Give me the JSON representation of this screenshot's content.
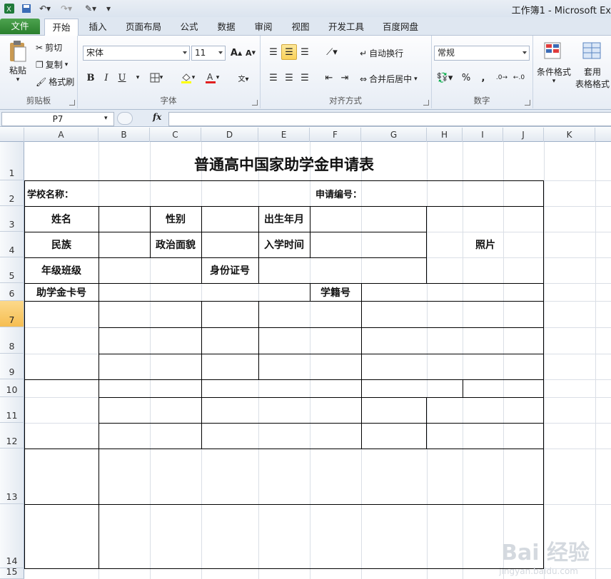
{
  "window": {
    "title": "工作簿1 - Microsoft Ex"
  },
  "tabs": [
    {
      "label": "文件"
    },
    {
      "label": "开始"
    },
    {
      "label": "插入"
    },
    {
      "label": "页面布局"
    },
    {
      "label": "公式"
    },
    {
      "label": "数据"
    },
    {
      "label": "审阅"
    },
    {
      "label": "视图"
    },
    {
      "label": "开发工具"
    },
    {
      "label": "百度网盘"
    }
  ],
  "ribbon": {
    "clipboard": {
      "name": "剪贴板",
      "paste": "粘贴",
      "cut": "剪切",
      "copy": "复制",
      "format_painter": "格式刷"
    },
    "font": {
      "name": "字体",
      "font_name": "宋体",
      "font_size": "11",
      "bold": "B",
      "italic": "I",
      "underline": "U"
    },
    "alignment": {
      "name": "对齐方式",
      "wrap_text": "自动换行",
      "merge_center": "合并后居中"
    },
    "number": {
      "name": "数字",
      "format": "常规",
      "percent": "%",
      "comma": ","
    },
    "styles": {
      "conditional_format": "条件格式",
      "table_format_1": "套用",
      "table_format_2": "表格格式"
    }
  },
  "formula_bar": {
    "name_box": "P7",
    "fx": "fx",
    "value": ""
  },
  "grid": {
    "columns": [
      "A",
      "B",
      "C",
      "D",
      "E",
      "F",
      "G",
      "H",
      "I",
      "J",
      "K"
    ],
    "rows": [
      "1",
      "2",
      "3",
      "4",
      "5",
      "6",
      "7",
      "8",
      "9",
      "10",
      "11",
      "12",
      "13",
      "14",
      "15"
    ],
    "selected_row": "7"
  },
  "form": {
    "title": "普通高中国家助学金申请表",
    "school_name": "学校名称：",
    "app_number": "申请编号：",
    "name": "姓名",
    "gender": "性别",
    "birth": "出生年月",
    "ethnicity": "民族",
    "political": "政治面貌",
    "enroll_time": "入学时间",
    "photo": "照片",
    "grade_class": "年级班级",
    "id_number": "身份证号",
    "card_number": "助学金卡号",
    "student_id": "学籍号"
  },
  "watermark": {
    "brand": "Bai 经验",
    "url": "jingyan.baidu.com"
  }
}
